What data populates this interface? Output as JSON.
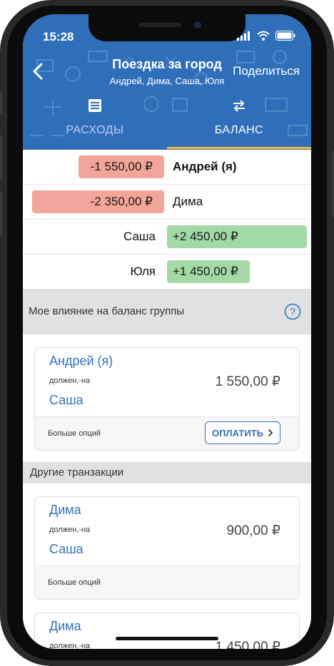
{
  "status_bar": {
    "time": "15:28"
  },
  "header": {
    "title": "Поездка за город",
    "members": "Андрей, Дима, Саша, Юля",
    "share_label": "Поделиться"
  },
  "tabs": [
    {
      "label": "РАСХОДЫ",
      "icon": "list-icon",
      "active": false
    },
    {
      "label": "БАЛАНС",
      "icon": "transfer-icon",
      "active": true
    }
  ],
  "colors": {
    "header_blue": "#2f6fba",
    "negative_balance": "#f2a598",
    "positive_balance": "#a3d9a5",
    "tab_indicator": "#f5b82e",
    "link_blue": "#3172b9"
  },
  "balances": [
    {
      "name": "Андрей (я)",
      "amount": "-1 550,00 ₽",
      "sign": "negative",
      "bold": true
    },
    {
      "name": "Дима",
      "amount": "-2 350,00 ₽",
      "sign": "negative",
      "bold": false
    },
    {
      "name": "Саша",
      "amount": "+2 450,00 ₽",
      "sign": "positive",
      "bold": false
    },
    {
      "name": "Юля",
      "amount": "+1 450,00 ₽",
      "sign": "positive",
      "bold": false
    }
  ],
  "impact_section": {
    "title": "Мое влияние на баланс группы",
    "card": {
      "from": "Андрей (я)",
      "owes": "должен,-на",
      "to": "Саша",
      "amount": "1 550,00 ₽",
      "more_label": "Больше опций",
      "pay_label": "ОПЛАТИТЬ"
    }
  },
  "other_section": {
    "title": "Другие транзакции",
    "cards": [
      {
        "from": "Дима",
        "owes": "должен,-на",
        "to": "Саша",
        "amount": "900,00 ₽",
        "more_label": "Больше опций"
      },
      {
        "from": "Дима",
        "owes": "должен,-на",
        "to": "",
        "amount": "1 450,00 ₽",
        "more_label": ""
      }
    ]
  }
}
